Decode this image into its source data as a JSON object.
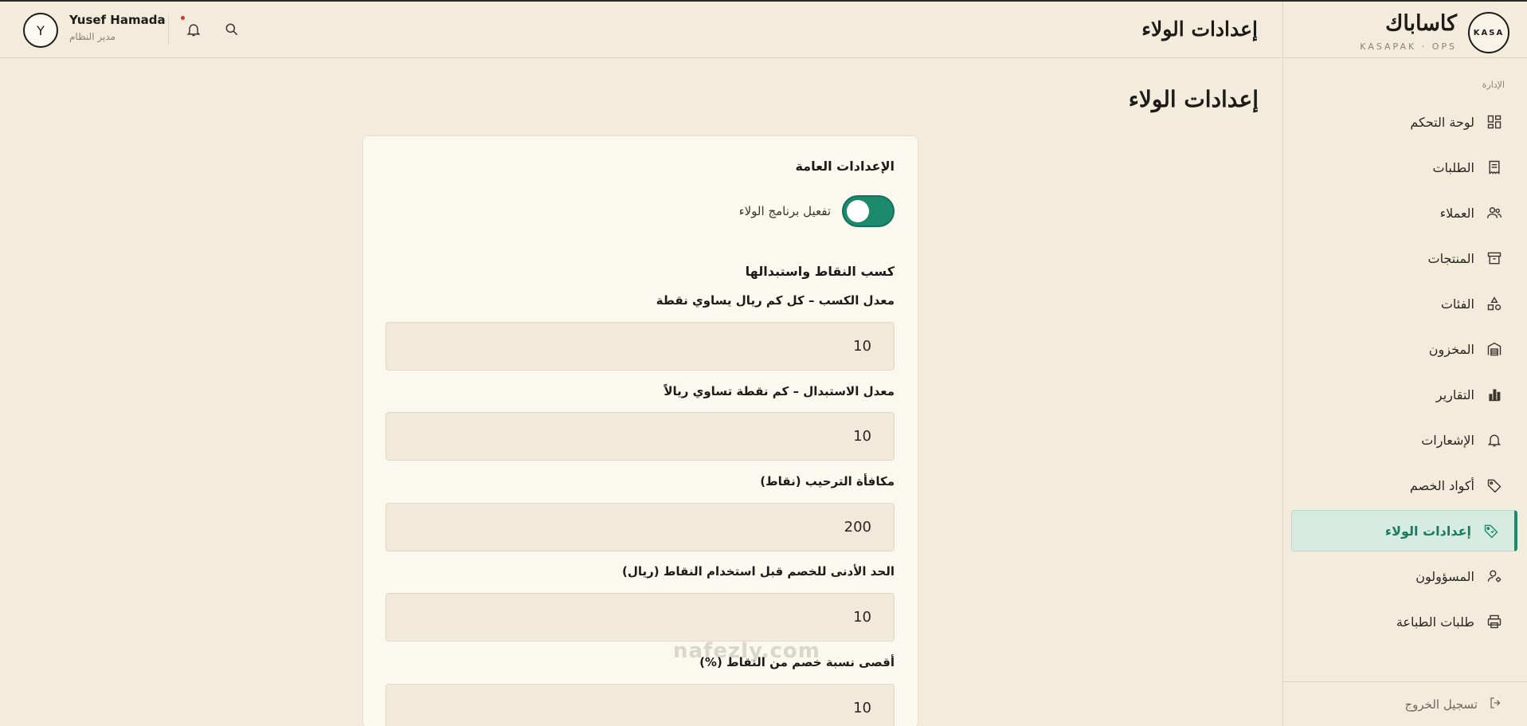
{
  "sidebar": {
    "logo_text": "KASA",
    "brand_name": "كاساباك",
    "brand_sub": "KASAPAK · OPS",
    "section_label": "الإدارة",
    "items": [
      {
        "label": "لوحة التحكم",
        "icon": "dashboard-icon"
      },
      {
        "label": "الطلبات",
        "icon": "receipt-icon"
      },
      {
        "label": "العملاء",
        "icon": "users-icon"
      },
      {
        "label": "المنتجات",
        "icon": "archive-icon"
      },
      {
        "label": "الفئات",
        "icon": "shapes-icon"
      },
      {
        "label": "المخزون",
        "icon": "warehouse-icon"
      },
      {
        "label": "التقارير",
        "icon": "bar-chart-icon"
      },
      {
        "label": "الإشعارات",
        "icon": "bell-icon"
      },
      {
        "label": "أكواد الخصم",
        "icon": "tag-icon"
      },
      {
        "label": "إعدادات الولاء",
        "icon": "loyalty-tag-icon"
      },
      {
        "label": "المسؤولون",
        "icon": "user-cog-icon"
      },
      {
        "label": "طلبات الطباعة",
        "icon": "printer-icon"
      }
    ],
    "active_index": 9,
    "logout": "تسجيل الخروج"
  },
  "topbar": {
    "title": "إعدادات الولاء",
    "user_initial": "Y",
    "user_name": "Yusef Hamada",
    "user_role": "مدير النظام"
  },
  "main": {
    "heading": "إعدادات الولاء",
    "general_title": "الإعدادات العامة",
    "toggle_label": "تفعيل برنامج الولاء",
    "toggle_on": true,
    "earn_title": "كسب النقاط واستبدالها",
    "fields": [
      {
        "label": "معدل الكسب – كل كم ريال يساوي نقطة",
        "value": "10"
      },
      {
        "label": "معدل الاستبدال – كم نقطة تساوي ريالاً",
        "value": "10"
      },
      {
        "label": "مكافأة الترحيب (نقاط)",
        "value": "200"
      },
      {
        "label": "الحد الأدنى للخصم قبل استخدام النقاط (ريال)",
        "value": "10"
      },
      {
        "label": "أقصى نسبة خصم من النقاط (%)",
        "value": "10"
      }
    ]
  },
  "watermark": "nafezly.com",
  "colors": {
    "background": "#f3ecdd",
    "card": "#fbf8f0",
    "accent": "#1c8a6c",
    "active_bg": "#d6ece2"
  }
}
